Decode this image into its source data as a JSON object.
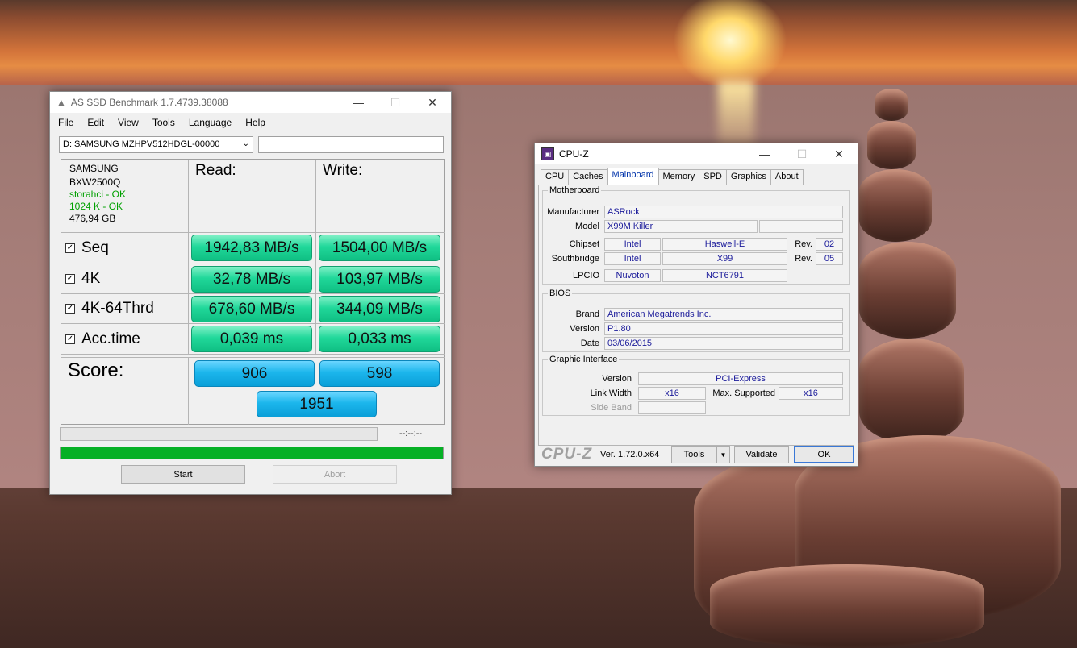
{
  "asssd": {
    "title": "AS SSD Benchmark 1.7.4739.38088",
    "menu": [
      "File",
      "Edit",
      "View",
      "Tools",
      "Language",
      "Help"
    ],
    "drive_select": "D: SAMSUNG MZHPV512HDGL-00000",
    "drive_info": {
      "vendor": "SAMSUNG",
      "firmware": "BXW2500Q",
      "driver": "storahci - OK",
      "alignment": "1024 K - OK",
      "size": "476,94 GB"
    },
    "read_header": "Read:",
    "write_header": "Write:",
    "tests": [
      {
        "label": "Seq",
        "read": "1942,83 MB/s",
        "write": "1504,00 MB/s"
      },
      {
        "label": "4K",
        "read": "32,78 MB/s",
        "write": "103,97 MB/s"
      },
      {
        "label": "4K-64Thrd",
        "read": "678,60 MB/s",
        "write": "344,09 MB/s"
      },
      {
        "label": "Acc.time",
        "read": "0,039 ms",
        "write": "0,033 ms"
      }
    ],
    "score_label": "Score:",
    "score_read": "906",
    "score_write": "598",
    "score_total": "1951",
    "elapsed": "--:--:--",
    "progress": 1.0,
    "start_label": "Start",
    "abort_label": "Abort"
  },
  "cpuz": {
    "title": "CPU-Z",
    "tabs": [
      "CPU",
      "Caches",
      "Mainboard",
      "Memory",
      "SPD",
      "Graphics",
      "About"
    ],
    "motherboard": {
      "legend": "Motherboard",
      "manufacturer_label": "Manufacturer",
      "manufacturer": "ASRock",
      "model_label": "Model",
      "model": "X99M Killer",
      "chipset_label": "Chipset",
      "chipset_vendor": "Intel",
      "chipset_name": "Haswell-E",
      "chipset_rev": "02",
      "southbridge_label": "Southbridge",
      "southbridge_vendor": "Intel",
      "southbridge_name": "X99",
      "southbridge_rev": "05",
      "rev_label": "Rev.",
      "lpcio_label": "LPCIO",
      "lpcio_vendor": "Nuvoton",
      "lpcio_name": "NCT6791"
    },
    "bios": {
      "legend": "BIOS",
      "brand_label": "Brand",
      "brand": "American Megatrends Inc.",
      "version_label": "Version",
      "version": "P1.80",
      "date_label": "Date",
      "date": "03/06/2015"
    },
    "graphic": {
      "legend": "Graphic Interface",
      "version_label": "Version",
      "version": "PCI-Express",
      "link_width_label": "Link Width",
      "link_width": "x16",
      "max_supported_label": "Max. Supported",
      "max_supported": "x16",
      "side_band_label": "Side Band"
    },
    "footer": {
      "logo": "CPU-Z",
      "version": "Ver. 1.72.0.x64",
      "tools": "Tools",
      "validate": "Validate",
      "ok": "OK"
    }
  }
}
